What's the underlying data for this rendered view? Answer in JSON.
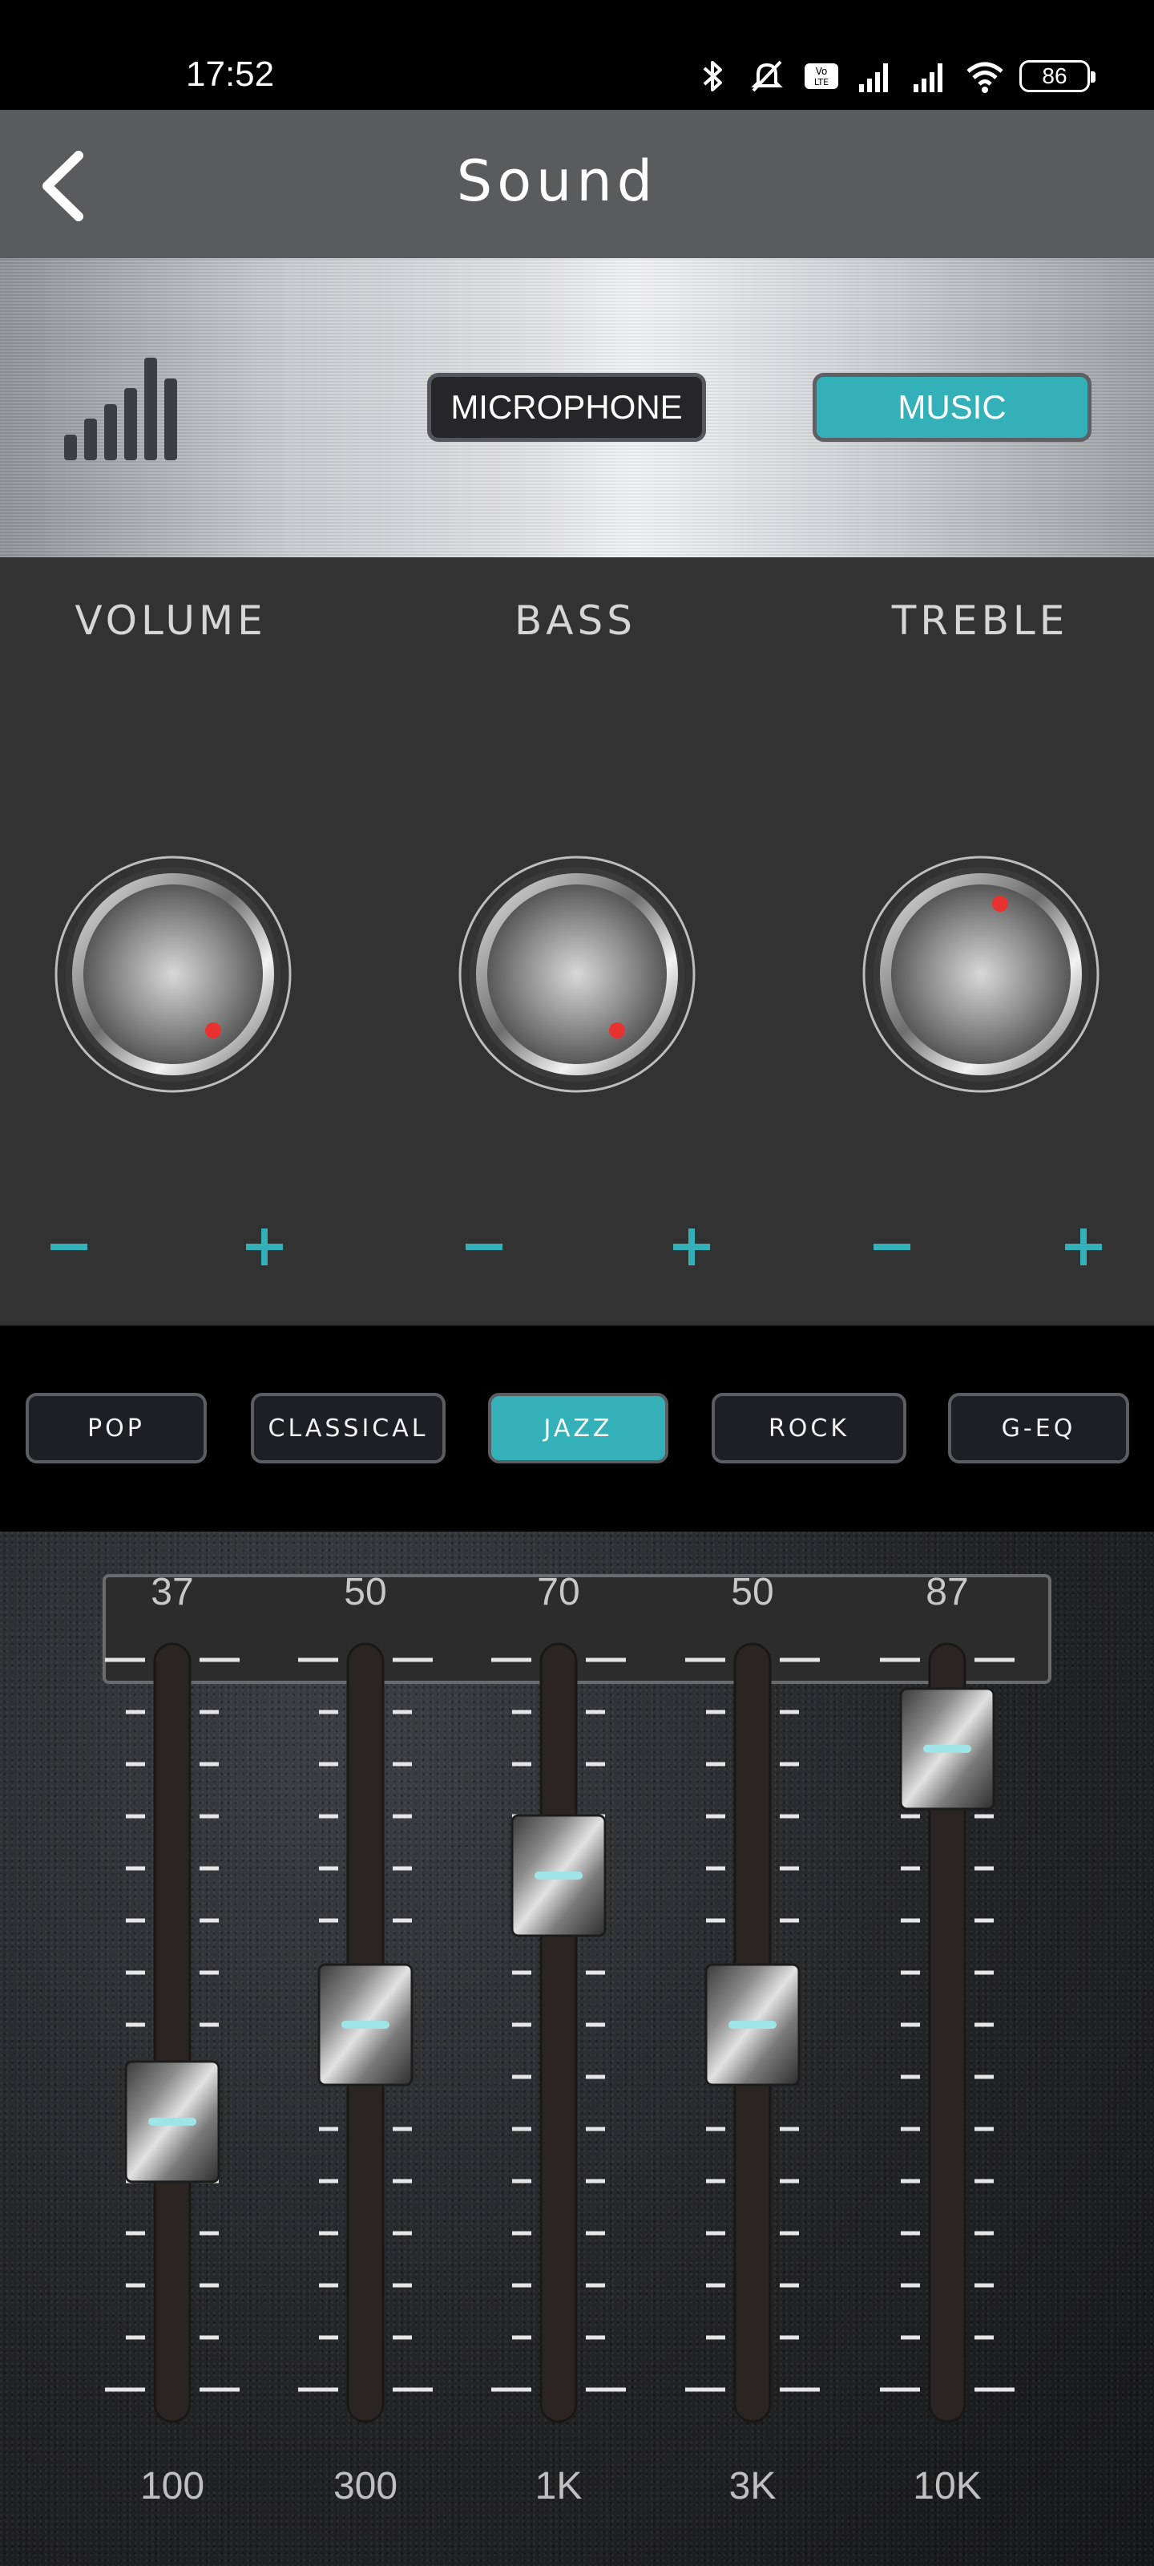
{
  "status_bar": {
    "time": "17:52",
    "battery": "86",
    "icons": [
      "bluetooth-icon",
      "mute-icon",
      "volte-icon",
      "signal-icon",
      "signal-icon",
      "wifi-icon",
      "battery-icon"
    ]
  },
  "header": {
    "title": "Sound",
    "back_icon": "chevron-left-icon"
  },
  "source": {
    "icon": "signal-bars-icon",
    "microphone_label": "MICROPHONE",
    "music_label": "MUSIC",
    "selected": "MUSIC"
  },
  "colors": {
    "accent": "#34b1b8",
    "knob_indicator": "#e8322f"
  },
  "knobs": [
    {
      "label": "VOLUME",
      "minus": "−",
      "plus": "+"
    },
    {
      "label": "BASS",
      "minus": "−",
      "plus": "+"
    },
    {
      "label": "TREBLE",
      "minus": "−",
      "plus": "+"
    }
  ],
  "presets": {
    "items": [
      {
        "label": "POP"
      },
      {
        "label": "CLASSICAL"
      },
      {
        "label": "JAZZ"
      },
      {
        "label": "ROCK"
      },
      {
        "label": "G-EQ"
      }
    ],
    "selected": "JAZZ"
  },
  "equalizer": {
    "range": [
      0,
      100
    ],
    "bands": [
      {
        "freq": "100",
        "value": 37
      },
      {
        "freq": "300",
        "value": 50
      },
      {
        "freq": "1K",
        "value": 70
      },
      {
        "freq": "3K",
        "value": 50
      },
      {
        "freq": "10K",
        "value": 87
      }
    ]
  }
}
